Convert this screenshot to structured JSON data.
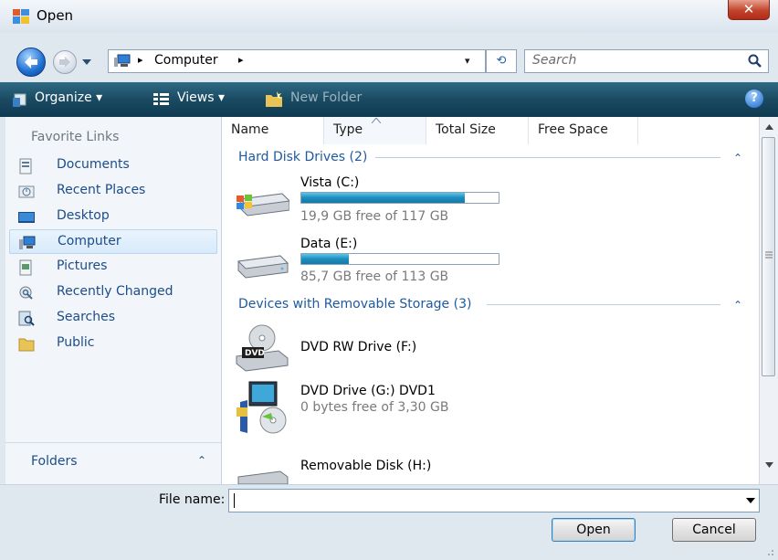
{
  "window": {
    "title": "Open"
  },
  "address": {
    "location": "Computer",
    "sep": "▸",
    "dropdown": "▾"
  },
  "search": {
    "placeholder": "Search"
  },
  "toolbar": {
    "organize": "Organize ▾",
    "views": "Views ▾",
    "new_folder": "New Folder",
    "help": "?"
  },
  "sidebar": {
    "header": "Favorite Links",
    "items": [
      {
        "label": "Documents",
        "icon": "documents-icon"
      },
      {
        "label": "Recent Places",
        "icon": "recent-places-icon"
      },
      {
        "label": "Desktop",
        "icon": "desktop-icon"
      },
      {
        "label": "Computer",
        "icon": "computer-icon",
        "selected": true
      },
      {
        "label": "Pictures",
        "icon": "pictures-icon"
      },
      {
        "label": "Recently Changed",
        "icon": "recently-changed-icon"
      },
      {
        "label": "Searches",
        "icon": "searches-icon"
      },
      {
        "label": "Public",
        "icon": "public-folder-icon"
      }
    ],
    "folders_label": "Folders",
    "folders_chevron": "⌃"
  },
  "columns": [
    "Name",
    "Type",
    "Total Size",
    "Free Space"
  ],
  "groups": {
    "hard_disks": {
      "title": "Hard Disk Drives (2)",
      "items": [
        {
          "name": "Vista (C:)",
          "free_text": "19,9 GB free of 117 GB",
          "used_fraction": 0.83
        },
        {
          "name": "Data (E:)",
          "free_text": "85,7 GB free of 113 GB",
          "used_fraction": 0.24
        }
      ]
    },
    "removable": {
      "title": "Devices with Removable Storage (3)",
      "items": [
        {
          "name": "DVD RW Drive (F:)",
          "badge": "DVD"
        },
        {
          "name": "DVD Drive (G:) DVD1",
          "sub": "0 bytes free of 3,30 GB"
        },
        {
          "name": "Removable Disk (H:)"
        }
      ]
    },
    "chevron": "⌃"
  },
  "bottom": {
    "file_name_label": "File name:",
    "file_name_value": "",
    "open_label": "Open",
    "cancel_label": "Cancel"
  },
  "colors": {
    "toolbar": "#1a4a62",
    "link": "#1c4d8a",
    "group": "#1d5aa0",
    "bar": "#1d8dbf"
  }
}
